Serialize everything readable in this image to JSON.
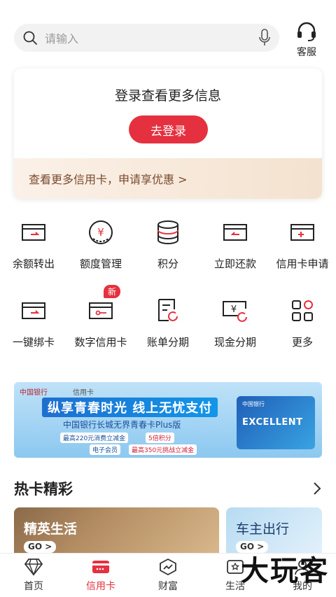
{
  "search": {
    "placeholder": "请输入"
  },
  "service": {
    "label": "客服"
  },
  "login_card": {
    "title": "登录查看更多信息",
    "button": "去登录",
    "promo": "查看更多信用卡，申请享优惠 >"
  },
  "grid_row1": [
    {
      "label": "余额转出",
      "icon": "card-transfer-icon"
    },
    {
      "label": "额度管理",
      "icon": "yuan-circle-icon"
    },
    {
      "label": "积分",
      "icon": "coin-stack-icon"
    },
    {
      "label": "立即还款",
      "icon": "card-repay-icon"
    },
    {
      "label": "信用卡申请",
      "icon": "card-apply-icon"
    }
  ],
  "grid_row2": [
    {
      "label": "一键绑卡",
      "icon": "card-bind-icon"
    },
    {
      "label": "数字信用卡",
      "icon": "digital-card-icon",
      "badge": "新"
    },
    {
      "label": "账单分期",
      "icon": "bill-installment-icon"
    },
    {
      "label": "现金分期",
      "icon": "cash-installment-icon"
    },
    {
      "label": "更多",
      "icon": "grid-more-icon"
    }
  ],
  "banner": {
    "bank_name": "中国银行",
    "bank_en": "BANK OF CHINA",
    "card_type": "信用卡",
    "slogan": "纵享青春时光 线上无忧支付",
    "subtitle": "中国银行长城无界青春卡Plus版",
    "chip1": "最高220元消费立减金",
    "chip2": "5倍积分",
    "chip3": "电子会员",
    "chip4": "最高350元挑战立减金",
    "card_text": "EXCELLENT"
  },
  "section": {
    "title": "热卡精彩"
  },
  "hot_cards": [
    {
      "title": "精英生活",
      "go": "GO >"
    },
    {
      "title": "车主出行",
      "go": "GO >"
    }
  ],
  "tabbar": [
    {
      "label": "首页",
      "icon": "diamond-icon",
      "active": false
    },
    {
      "label": "信用卡",
      "icon": "credit-card-icon",
      "active": true
    },
    {
      "label": "财富",
      "icon": "wealth-chart-icon",
      "active": false
    },
    {
      "label": "生活",
      "icon": "life-icon",
      "active": false
    },
    {
      "label": "我的",
      "icon": "profile-icon",
      "active": false
    }
  ],
  "watermark": "大玩客",
  "colors": {
    "accent": "#e5313f",
    "promo_text": "#7a4a2e"
  }
}
